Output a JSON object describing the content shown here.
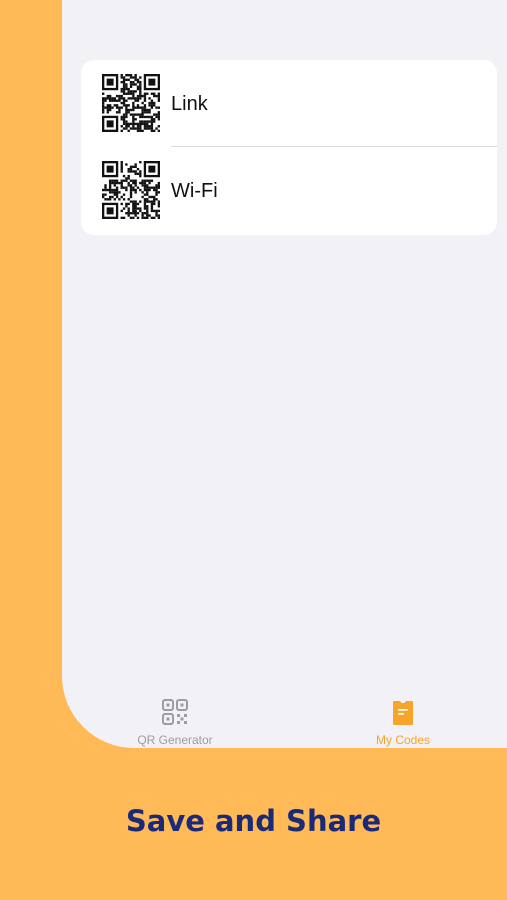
{
  "saved_codes": {
    "items": [
      {
        "label": "Link",
        "icon": "qr-code-icon"
      },
      {
        "label": "Wi-Fi",
        "icon": "qr-code-icon"
      }
    ]
  },
  "tab_bar": {
    "tabs": [
      {
        "label": "QR Generator",
        "icon": "qr-generator-icon",
        "selected": false
      },
      {
        "label": "My Codes",
        "icon": "my-codes-icon",
        "selected": true
      }
    ],
    "active_color": "#F7A42C",
    "inactive_color": "#9C9CA3"
  },
  "promo": {
    "caption": "Save and Share"
  },
  "colors": {
    "background": "#FFB957",
    "screen": "#F1F1F6",
    "caption": "#1A2A78"
  }
}
